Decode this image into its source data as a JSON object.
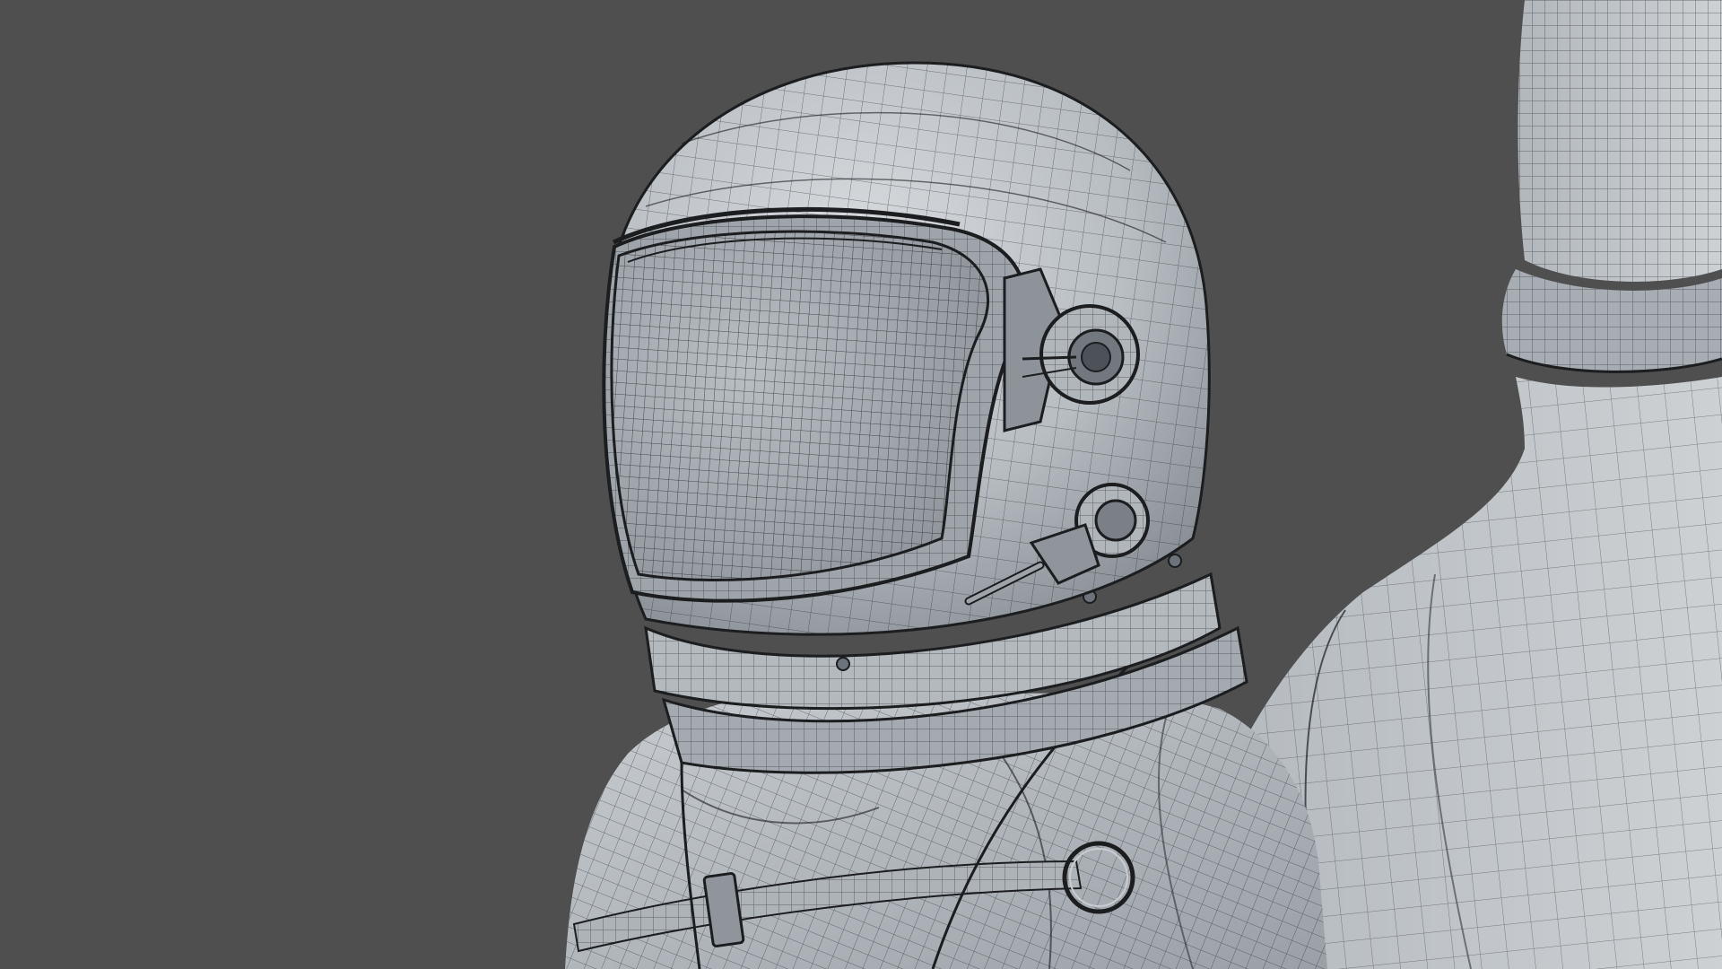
{
  "scene": {
    "subject": "astronaut-wireframe-render",
    "colors": {
      "background": "#4f4f4f",
      "surface_light": "#cfd3d6",
      "surface_mid": "#a9aeb3",
      "surface_dark": "#6d737a",
      "wire": "#1c1d1f"
    }
  }
}
